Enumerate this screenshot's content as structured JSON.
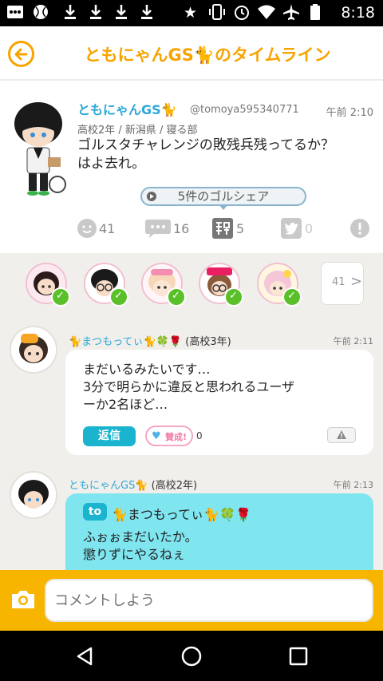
{
  "status_bar": {
    "time": "8:18",
    "left_icons": [
      "notification-icon",
      "sports-ball-icon",
      "download-icon",
      "download-icon",
      "download-icon",
      "download-icon"
    ],
    "right_icons": [
      "star-icon",
      "vibrate-icon",
      "alarm-icon",
      "wifi-icon",
      "airplane-icon",
      "battery-icon"
    ]
  },
  "header": {
    "title": "ともにゃんGS🐈のタイムライン",
    "back_icon": "back-arrow-icon",
    "accent_color": "#f7a400"
  },
  "post": {
    "author_name": "ともにゃんGS🐈",
    "handle": "@tomoya595340771",
    "time": "午前 2:10",
    "meta": "高校2年 / 新潟県 / 寝る部",
    "text_line1": "ゴルスタチャレンジの敗残兵残ってるか？",
    "text_line2": "はよ去れ。",
    "share_label": "5件のゴルシェア",
    "actions": {
      "reactions": "41",
      "comments": "16",
      "golshare": "5",
      "twitter": "0"
    }
  },
  "ranking": {
    "more_count": "41"
  },
  "comments": [
    {
      "name": "🐈まつもってぃ🐈🍀🌹",
      "grade": "(高校3年)",
      "time": "午前 2:11",
      "line1": "まだいるみたいです…",
      "line2": "3分で明らかに違反と思われるユーザ",
      "line3": "ーか2名ほど…",
      "reply_label": "返信",
      "like_label": "賛成!",
      "like_count": "0"
    },
    {
      "name": "ともにゃんGS🐈",
      "grade": "(高校2年)",
      "time": "午前 2:13",
      "to_label": "to",
      "to_name": "🐈まつもってぃ🐈🍀🌹",
      "line1": "ふぉぉまだいたか。",
      "line2": "懲りずにやるねぇ"
    }
  ],
  "input": {
    "placeholder": "コメントしよう"
  },
  "nav": {
    "items": [
      "back-triangle-icon",
      "home-circle-icon",
      "recents-square-icon"
    ]
  }
}
